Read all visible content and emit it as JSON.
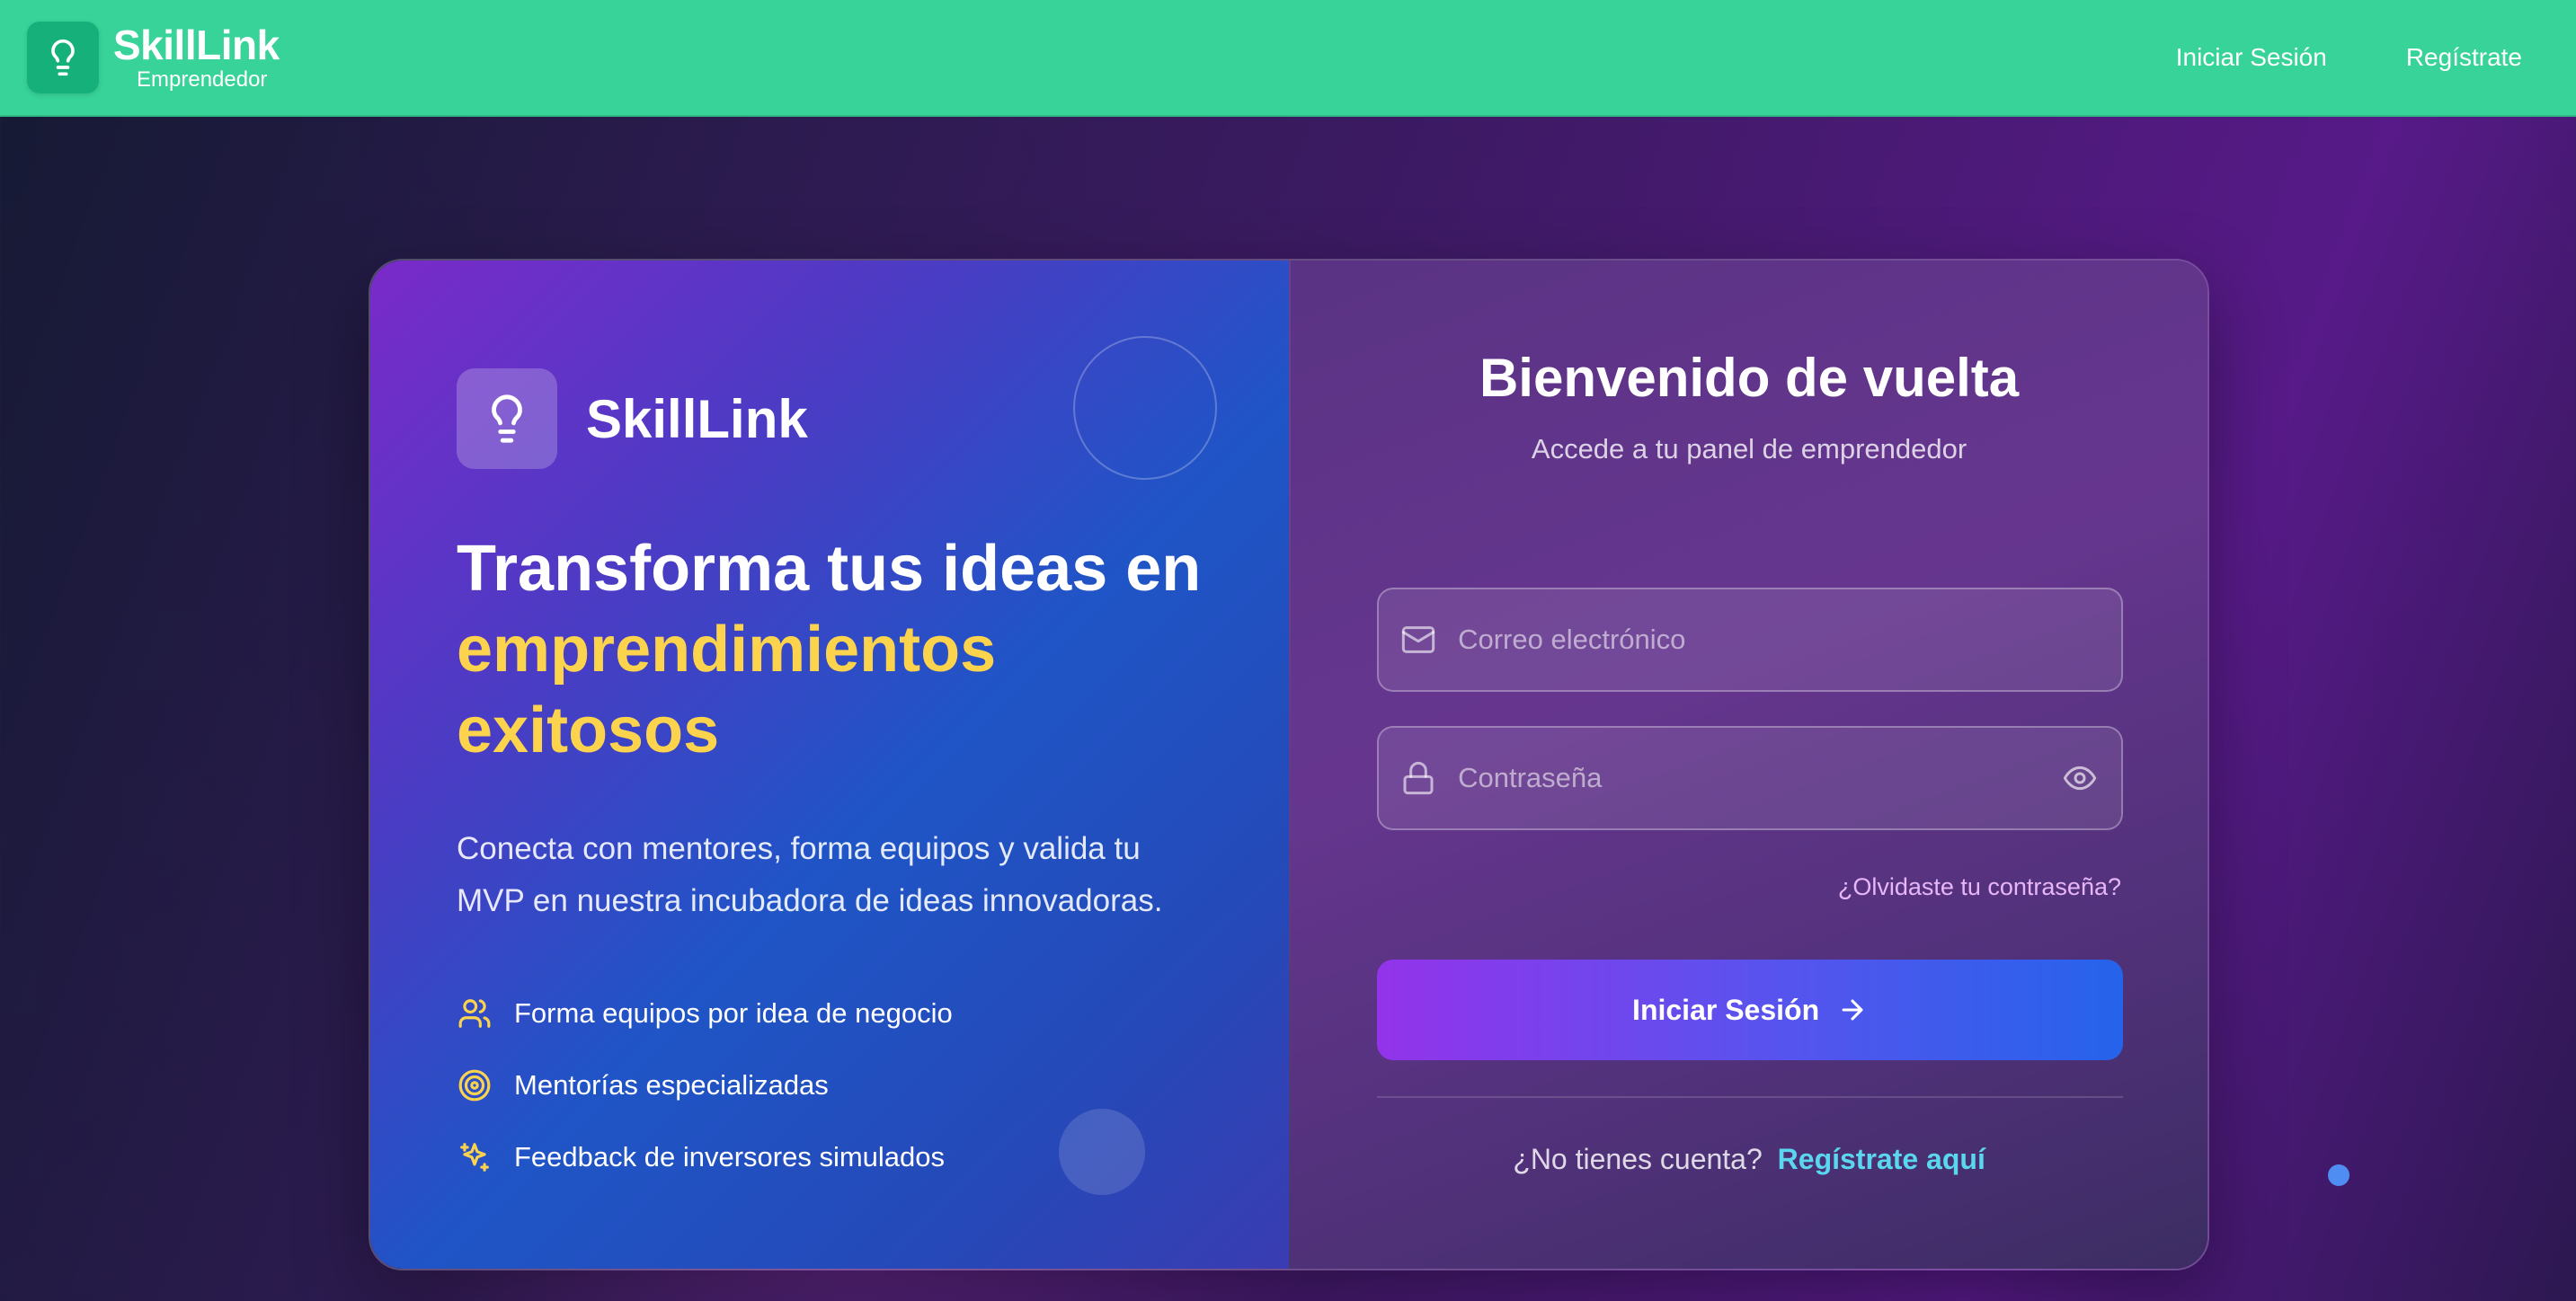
{
  "topbar": {
    "brand_title": "SkillLink",
    "brand_subtitle": "Emprendedor",
    "nav": {
      "login": "Iniciar Sesión",
      "register": "Regístrate"
    }
  },
  "left_panel": {
    "brand_name": "SkillLink",
    "headline_white": "Transforma tus ideas en",
    "headline_yellow_1": "emprendimientos",
    "headline_yellow_2": "exitosos",
    "description": "Conecta con mentores, forma equipos y valida tu MVP en nuestra incubadora de ideas innovadoras.",
    "features": [
      {
        "icon": "users-icon",
        "label": "Forma equipos por idea de negocio"
      },
      {
        "icon": "target-icon",
        "label": "Mentorías especializadas"
      },
      {
        "icon": "sparkles-icon",
        "label": "Feedback de inversores simulados"
      }
    ]
  },
  "login_form": {
    "title": "Bienvenido de vuelta",
    "subtitle": "Accede a tu panel de emprendedor",
    "email_placeholder": "Correo electrónico",
    "email_value": "",
    "password_placeholder": "Contraseña",
    "password_value": "",
    "forgot_password": "¿Olvidaste tu contraseña?",
    "submit_label": "Iniciar Sesión",
    "no_account_text": "¿No tienes cuenta?",
    "register_link": "Regístrate aquí"
  },
  "colors": {
    "topbar": "#37d399",
    "accent_yellow": "#fcd34d",
    "link_cyan": "#5ad6ee",
    "button_start": "#9333ea",
    "button_end": "#2563eb"
  }
}
